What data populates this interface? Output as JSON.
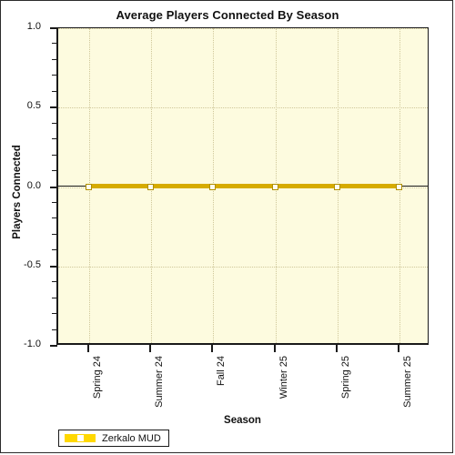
{
  "chart_data": {
    "type": "line",
    "title": "Average Players Connected By Season",
    "xlabel": "Season",
    "ylabel": "Players Connected",
    "categories": [
      "Spring 24",
      "Summer 24",
      "Fall 24",
      "Winter 25",
      "Spring 25",
      "Summer 25"
    ],
    "series": [
      {
        "name": "Zerkalo MUD",
        "values": [
          0,
          0,
          0,
          0,
          0,
          0
        ],
        "color": "#d6ab00",
        "marker": "open-square"
      }
    ],
    "ylim": [
      -1.0,
      1.0
    ],
    "ytick_labels": [
      "1.0",
      "0.5",
      "0.0",
      "-0.5",
      "-1.0"
    ],
    "ytick_values": [
      1.0,
      0.5,
      0.0,
      -0.5,
      -1.0
    ],
    "yminor_step": 0.1,
    "grid": "dotted",
    "legend_position": "bottom-left",
    "plot_background": "#fdfbdf",
    "page_background": "#ffffff",
    "axis_color": "#1a1a1a",
    "grid_color": "#cfc79a"
  },
  "legend": {
    "entries": [
      {
        "label": "Zerkalo MUD"
      }
    ]
  }
}
